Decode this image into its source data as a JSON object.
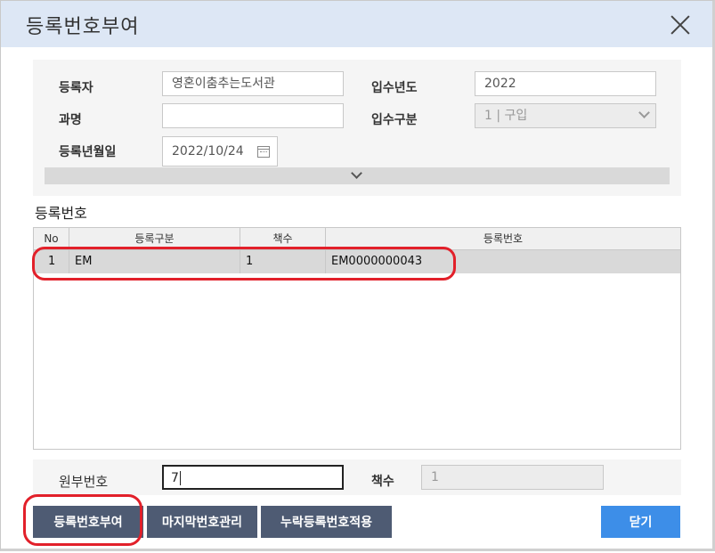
{
  "dialog": {
    "title": "등록번호부여"
  },
  "form": {
    "registrant_label": "등록자",
    "registrant_value": "영혼이춤추는도서관",
    "year_label": "입수년도",
    "year_value": "2022",
    "course_label": "과명",
    "course_value": "",
    "acquisition_label": "입수구분",
    "acquisition_value": "1 | 구입",
    "date_label": "등록년월일",
    "date_value": "2022/10/24"
  },
  "grid": {
    "section_title": "등록번호",
    "columns": [
      "No",
      "등록구분",
      "책수",
      "등록번호"
    ],
    "rows": [
      {
        "no": "1",
        "category": "EM",
        "copies": "1",
        "reg_number": "EM0000000043"
      }
    ]
  },
  "bottom": {
    "source_label": "원부번호",
    "source_value": "7",
    "copies_label": "책수",
    "copies_value": "1"
  },
  "buttons": {
    "assign": "등록번호부여",
    "last_number": "마지막번호관리",
    "missing": "누락등록번호적용",
    "close": "닫기"
  },
  "colors": {
    "title_bar": "#dde7f5",
    "dark_button": "#4e5b73",
    "blue_button": "#3d8ee8",
    "highlight": "#e2202a"
  }
}
